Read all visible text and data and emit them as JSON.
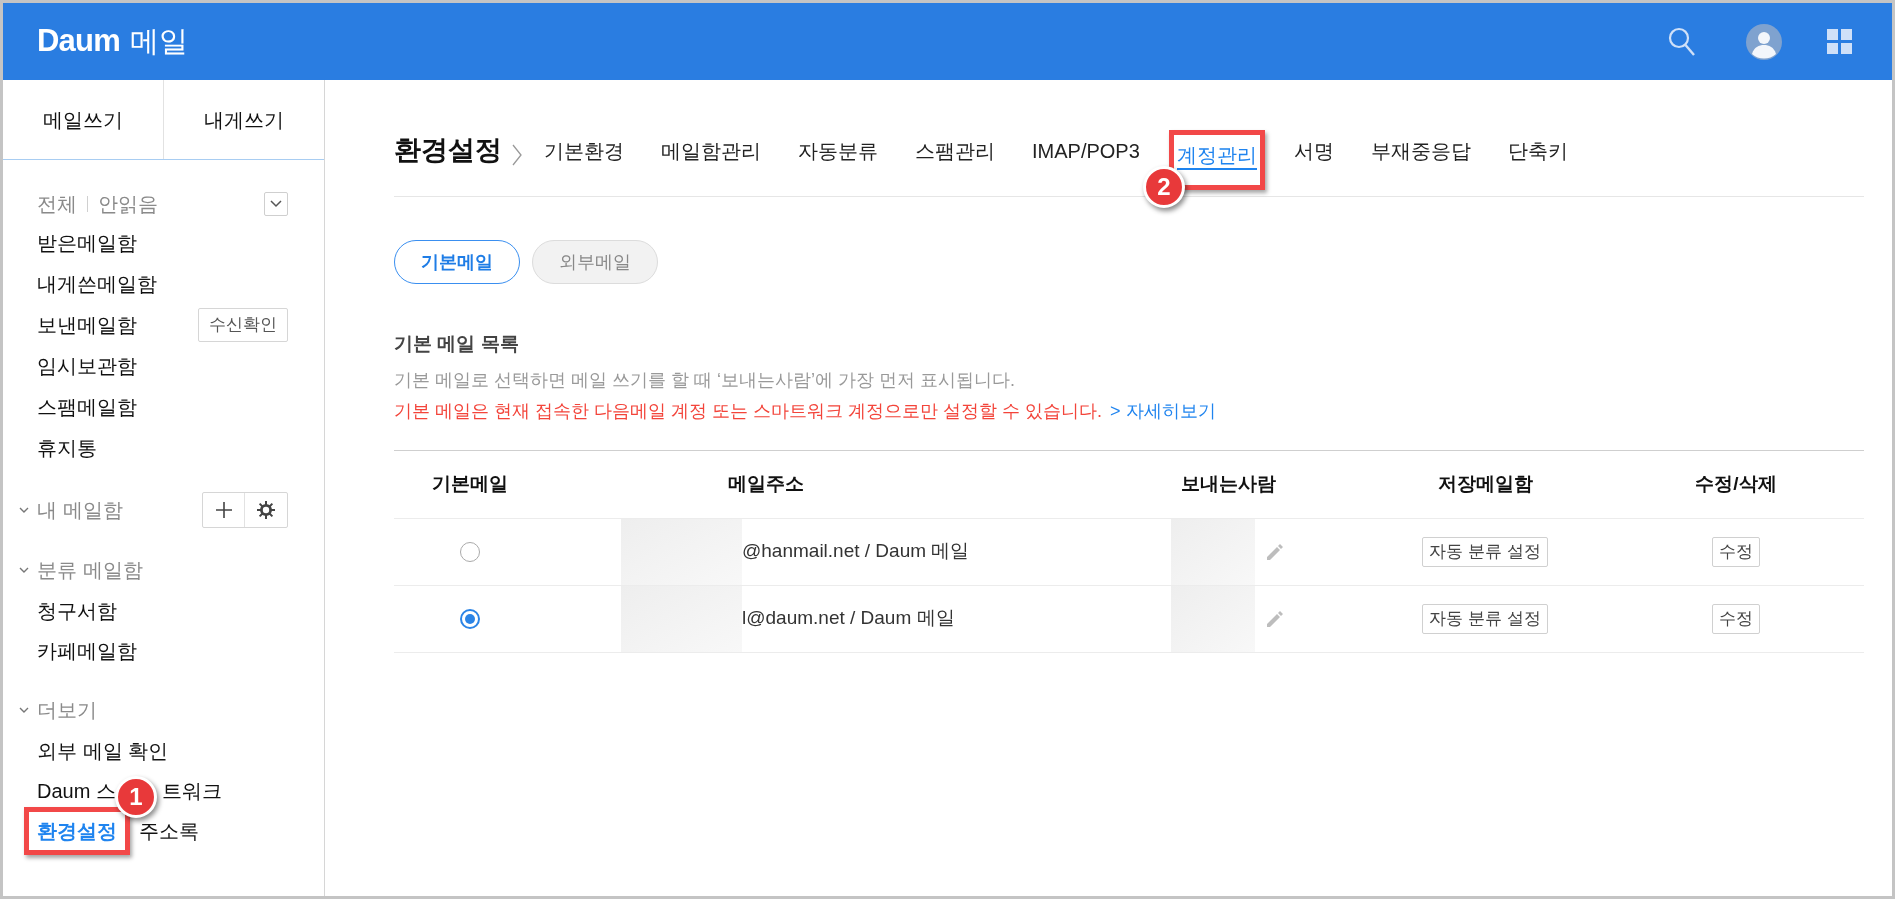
{
  "header": {
    "logo": "Daum",
    "service": "메일"
  },
  "sidebar": {
    "compose_buttons": [
      "메일쓰기",
      "내게쓰기"
    ],
    "filters": [
      "전체",
      "안읽음"
    ],
    "folders": [
      {
        "label": "받은메일함"
      },
      {
        "label": "내게쓴메일함"
      },
      {
        "label": "보낸메일함",
        "action": "수신확인"
      },
      {
        "label": "임시보관함"
      },
      {
        "label": "스팸메일함"
      },
      {
        "label": "휴지통"
      }
    ],
    "groups": [
      {
        "title": "내 메일함",
        "expanded": true,
        "tools": true
      },
      {
        "title": "분류 메일함",
        "expanded": true,
        "tools": false,
        "rows": [
          [
            {
              "label": "청구서함",
              "selected": false
            }
          ],
          [
            {
              "label": "카페메일함",
              "selected": false
            }
          ]
        ]
      },
      {
        "title": "더보기",
        "expanded": true,
        "tools": false,
        "rows": [
          [
            {
              "label": "외부 메일 확인",
              "selected": false
            }
          ],
          [
            {
              "label": "Daum 스",
              "label_end": "트워크",
              "selected": false
            }
          ],
          [
            {
              "label": "환경설정",
              "selected": true,
              "callout": "1"
            },
            {
              "label": "주소록",
              "selected": false
            }
          ]
        ]
      }
    ]
  },
  "main": {
    "title": "환경설정",
    "tabs": [
      {
        "label": "기본환경",
        "selected": false
      },
      {
        "label": "메일함관리",
        "selected": false
      },
      {
        "label": "자동분류",
        "selected": false
      },
      {
        "label": "스팸관리",
        "selected": false
      },
      {
        "label": "IMAP/POP3",
        "selected": false
      },
      {
        "label": "계정관리",
        "selected": true,
        "callout": "2"
      },
      {
        "label": "서명",
        "selected": false
      },
      {
        "label": "부재중응답",
        "selected": false
      },
      {
        "label": "단축키",
        "selected": false
      }
    ],
    "sub_tabs": [
      {
        "label": "기본메일",
        "selected": true
      },
      {
        "label": "외부메일",
        "selected": false
      }
    ],
    "section_title": "기본 메일 목록",
    "description": "기본 메일로 선택하면 메일 쓰기를 할 때 ‘보내는사람’에 가장 먼저 표시됩니다.",
    "warning": "기본 메일은 현재 접속한 다음메일 계정 또는 스마트워크 계정으로만 설정할 수 있습니다.",
    "link": "> 자세히보기",
    "table": {
      "columns": [
        "기본메일",
        "메일주소",
        "보내는사람",
        "저장메일함",
        "수정/삭제"
      ],
      "rows": [
        {
          "selected": false,
          "address": "@hanmail.net / Daum 메일",
          "folder_button": "자동 분류 설정",
          "edit_button": "수정"
        },
        {
          "selected": true,
          "address": "l@daum.net / Daum 메일",
          "folder_button": "자동 분류 설정",
          "edit_button": "수정"
        }
      ]
    }
  }
}
